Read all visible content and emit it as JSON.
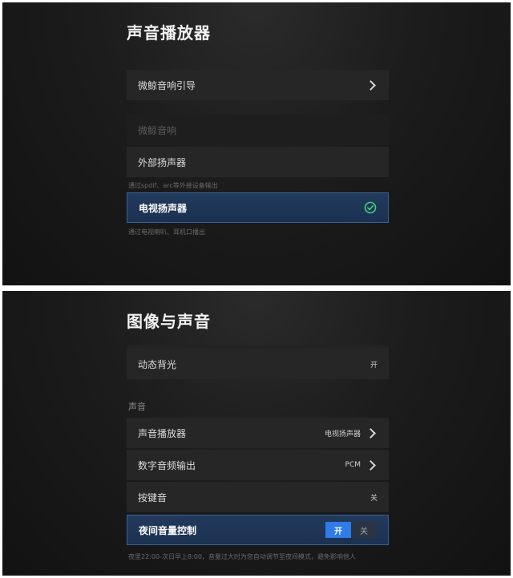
{
  "top_screen": {
    "title": "声音播放器",
    "rows": [
      {
        "label": "微鲸音响引导"
      },
      {
        "label": "微鲸音响"
      },
      {
        "label": "外部扬声器",
        "hint": "通过spdif、arc等外接设备输出"
      },
      {
        "label": "电视扬声器",
        "hint": "通过电视喇叭、耳机口播出"
      }
    ]
  },
  "bottom_screen": {
    "title": "图像与声音",
    "rows": {
      "dynamic_backlight": {
        "label": "动态背光",
        "value": "开"
      },
      "section_label": "声音",
      "sound_player": {
        "label": "声音播放器",
        "value": "电视扬声器"
      },
      "digital_audio_output": {
        "label": "数字音频输出",
        "value": "PCM"
      },
      "key_sound": {
        "label": "按键音",
        "value": "关"
      },
      "night_volume": {
        "label": "夜间音量控制",
        "on_label": "开",
        "off_label": "关"
      }
    },
    "hint": "夜里22:00-次日早上8:00，音量过大时为您自动调节至夜间模式，避免影响他人"
  },
  "colors": {
    "accent": "#2f7be8",
    "check": "#3fd17a",
    "selected_bg": "#1f3557"
  },
  "icons": [
    "chevron-right-icon",
    "check-circle-icon"
  ]
}
